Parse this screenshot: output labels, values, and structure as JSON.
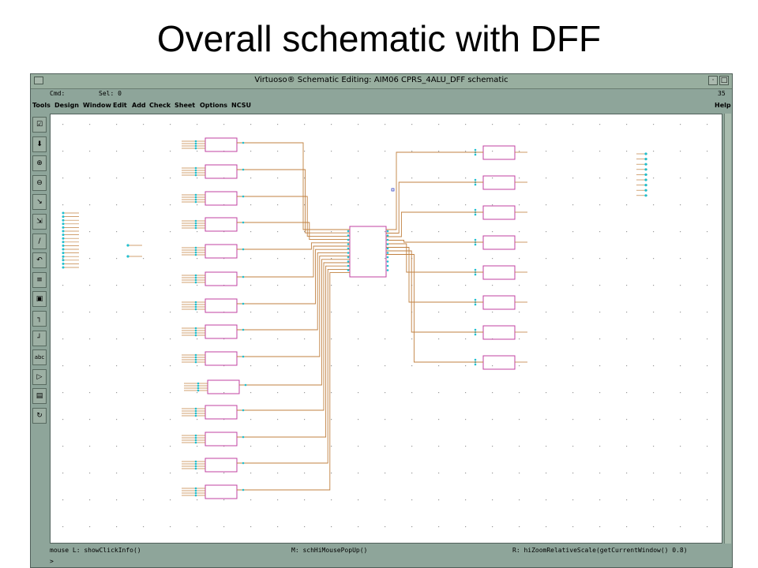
{
  "slide": {
    "title": "Overall schematic with DFF"
  },
  "window": {
    "title": "Virtuoso® Schematic Editing: AIM06 CPRS_4ALU_DFF schematic",
    "minimize_glyph": "·",
    "maximize_glyph": "□"
  },
  "cmdbar": {
    "cmd_label": "Cmd:",
    "sel_label": "Sel: 0",
    "count": "35"
  },
  "menu": {
    "items": [
      "Tools",
      "Design",
      "Window",
      "Edit",
      "Add",
      "Check",
      "Sheet",
      "Options",
      "NCSU"
    ],
    "help": "Help"
  },
  "toolbar": {
    "tools": [
      {
        "icon": "check-icon",
        "glyph": "☑"
      },
      {
        "icon": "save-icon",
        "glyph": "⬇"
      },
      {
        "icon": "zoom-in-icon",
        "glyph": "⊕"
      },
      {
        "icon": "zoom-out-icon",
        "glyph": "⊖"
      },
      {
        "icon": "stretch-icon",
        "glyph": "↘"
      },
      {
        "icon": "copy-icon",
        "glyph": "⇲"
      },
      {
        "icon": "wire-icon",
        "glyph": "∕"
      },
      {
        "icon": "undo-icon",
        "glyph": "↶"
      },
      {
        "icon": "bus-icon",
        "glyph": "≡"
      },
      {
        "icon": "instance-icon",
        "glyph": "▣"
      },
      {
        "icon": "wide-wire-icon",
        "glyph": "┐"
      },
      {
        "icon": "narrow-wire-icon",
        "glyph": "┘"
      },
      {
        "icon": "label-icon",
        "glyph": "abc"
      },
      {
        "icon": "pin-icon",
        "glyph": "▷"
      },
      {
        "icon": "property-icon",
        "glyph": "▤"
      },
      {
        "icon": "rotate-icon",
        "glyph": "↻"
      }
    ]
  },
  "status": {
    "mouse_left": "mouse L: showClickInfo()",
    "mouse_middle": "M: schHiMousePopUp()",
    "mouse_right": "R: hiZoomRelativeScale(getCurrentWindow() 0.8)"
  },
  "prompt": ">",
  "colors": {
    "wire": "#c08040",
    "instance": "#c040a0",
    "pin": "#20c0d0",
    "grid": "#9a9a9a"
  }
}
